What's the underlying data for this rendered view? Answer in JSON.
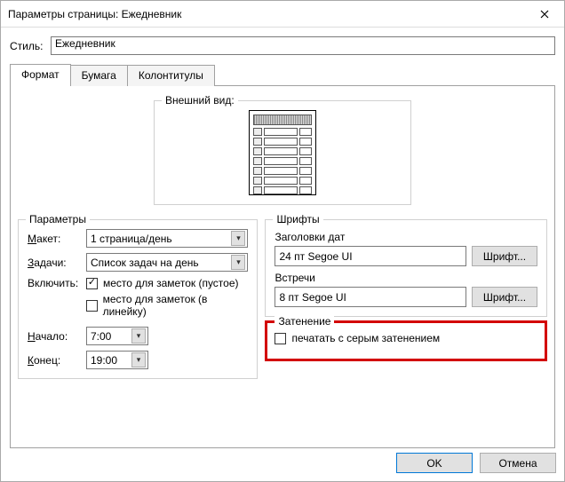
{
  "window": {
    "title": "Параметры страницы: Ежедневник"
  },
  "style": {
    "label": "Стиль:",
    "value": "Ежедневник"
  },
  "tabs": {
    "format": "Формат",
    "paper": "Бумага",
    "headers": "Колонтитулы"
  },
  "appearance": {
    "legend": "Внешний вид:"
  },
  "params": {
    "legend": "Параметры",
    "layout_label": "Макет:",
    "layout_value": "1 страница/день",
    "tasks_label": "Задачи:",
    "tasks_value": "Список задач на день",
    "include_label": "Включить:",
    "include_opt1": "место для заметок (пустое)",
    "include_opt2": "место для заметок (в линейку)",
    "start_label": "Начало:",
    "start_value": "7:00",
    "end_label": "Конец:",
    "end_value": "19:00"
  },
  "fonts": {
    "legend": "Шрифты",
    "dates_label": "Заголовки дат",
    "dates_value": "24 пт Segoe UI",
    "appts_label": "Встречи",
    "appts_value": "8 пт Segoe UI",
    "button": "Шрифт..."
  },
  "shading": {
    "legend": "Затенение",
    "option": "печатать с серым затенением"
  },
  "footer": {
    "ok": "OK",
    "cancel": "Отмена"
  }
}
